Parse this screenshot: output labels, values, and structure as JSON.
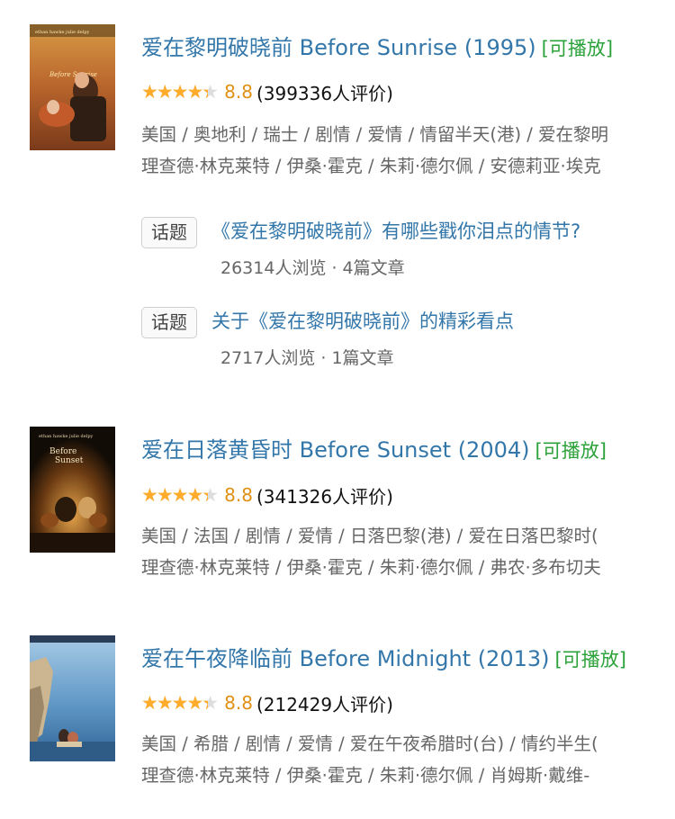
{
  "movies": [
    {
      "title": "爱在黎明破晓前 Before Sunrise (1995)",
      "playable": "[可播放]",
      "rating": "8.8",
      "rating_fraction": 0.88,
      "count": "(399336人评价)",
      "meta1": "美国 / 奥地利 / 瑞士 / 剧情 / 爱情 / 情留半天(港) / 爱在黎明",
      "meta2": "理查德·林克莱特 / 伊桑·霍克 / 朱莉·德尔佩 / 安德莉亚·埃克",
      "topics": [
        {
          "tag": "话题",
          "title": "《爱在黎明破晓前》有哪些戳你泪点的情节?",
          "stats": "26314人浏览 · 4篇文章"
        },
        {
          "tag": "话题",
          "title": "关于《爱在黎明破晓前》的精彩看点",
          "stats": "2717人浏览 · 1篇文章"
        }
      ]
    },
    {
      "title": "爱在日落黄昏时 Before Sunset (2004)",
      "playable": "[可播放]",
      "rating": "8.8",
      "rating_fraction": 0.88,
      "count": "(341326人评价)",
      "meta1": "美国 / 法国 / 剧情 / 爱情 / 日落巴黎(港) / 爱在日落巴黎时(",
      "meta2": "理查德·林克莱特 / 伊桑·霍克 / 朱莉·德尔佩 / 弗农·多布切夫"
    },
    {
      "title": "爱在午夜降临前 Before Midnight (2013)",
      "playable": "[可播放]",
      "rating": "8.8",
      "rating_fraction": 0.88,
      "count": "(212429人评价)",
      "meta1": "美国 / 希腊 / 剧情 / 爱情 / 爱在午夜希腊时(台) / 情约半生(",
      "meta2": "理查德·林克莱特 / 伊桑·霍克 / 朱莉·德尔佩 / 肖姆斯·戴维-"
    }
  ],
  "posters": [
    {
      "text_top": "ethan hawke   julie delpy",
      "text_title": "Before Sunrise",
      "palette": [
        "#c98a3a",
        "#a85a2a",
        "#e0c070"
      ]
    },
    {
      "text_top": "ethan hawke   julie delpy",
      "text_title": "Before Sunset",
      "palette": [
        "#1a1208",
        "#6a3a10",
        "#d0902a"
      ]
    },
    {
      "text_top": "",
      "text_title": "",
      "palette": [
        "#3a6fa0",
        "#7fb0d8",
        "#c8b89a"
      ]
    }
  ],
  "colors": {
    "link": "#3377aa",
    "playable": "#2ca23a",
    "star": "#ffac2d",
    "rating": "#e09015"
  }
}
